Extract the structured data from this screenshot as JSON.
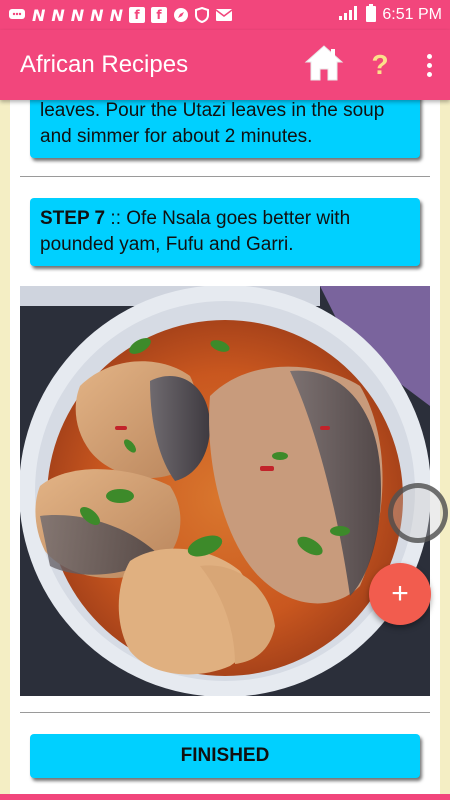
{
  "status_bar": {
    "time": "6:51 PM",
    "left_icons": [
      "message-icon",
      "n-icon",
      "n-icon",
      "n-icon",
      "n-icon",
      "n-icon",
      "facebook-icon",
      "facebook-icon",
      "compass-icon",
      "shield-icon",
      "email-icon"
    ],
    "n_glyph": "N",
    "fb_glyph": "f",
    "right_icons": [
      "signal-icon",
      "battery-icon"
    ]
  },
  "app_bar": {
    "title": "African Recipes",
    "help_glyph": "?",
    "actions": [
      "home-icon",
      "help-icon",
      "more-vert-icon"
    ]
  },
  "steps": [
    {
      "label": "",
      "text": "leaves. Pour the Utazi leaves in the soup and simmer for about 2 minutes."
    },
    {
      "label": "STEP 7",
      "separator": " :: ",
      "text": "Ofe Nsala goes better with pounded yam, Fufu and Garri."
    }
  ],
  "fab": {
    "glyph": "+",
    "icon": "add-icon"
  },
  "finished_button": {
    "label": "FINISHED"
  },
  "colors": {
    "primary": "#f2467c",
    "accent": "#00d0ff",
    "fab": "#f25c4e",
    "background": "#f4eec4"
  }
}
